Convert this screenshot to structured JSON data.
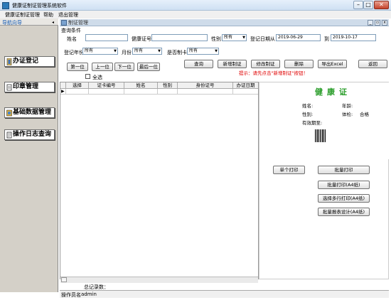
{
  "window": {
    "title": "健康证制证管理系统软件"
  },
  "menu": [
    "健康证制证管理",
    "帮助",
    "退出管理"
  ],
  "nav": {
    "title": "导航向导",
    "items": [
      "办证登记",
      "印章管理",
      "基础数据管理",
      "操作日志查询"
    ]
  },
  "inner": {
    "title": "制证管理"
  },
  "query": {
    "group_label": "查询条件",
    "name_label": "姓名",
    "name_value": "",
    "cert_label": "健康证号",
    "cert_value": "",
    "gender_label": "性别",
    "gender_value": "所有",
    "date_label": "登记日期从",
    "date_from": "2019-06-29",
    "date_to_label": "到",
    "date_to": "2019-10-17",
    "year_label": "登记年份",
    "year_value": "所有",
    "month_label": "月份",
    "month_value": "所有",
    "made_label": "是否制卡",
    "made_value": "所有",
    "first": "第一位",
    "prev": "上一位",
    "next": "下一位",
    "last": "最后一位",
    "select_all": "全选",
    "search": "查询",
    "add": "新增制证",
    "edit": "修改制证",
    "delete": "删除",
    "export": "导出Excel",
    "back": "返回",
    "hint": "提示：请先点击\"新增制证\"按钮！"
  },
  "grid": {
    "columns": [
      "选择",
      "证卡编号",
      "姓名",
      "性别",
      "身份证号",
      "办证日期"
    ]
  },
  "card": {
    "title": "健康证",
    "name_label": "姓名:",
    "age_label": "年龄:",
    "gender_label": "性别:",
    "result_label": "体检:",
    "result_value": "合格",
    "expiry_label": "有效期至:"
  },
  "print": {
    "single": "单个打印",
    "batch": "批量打印",
    "batch_a4": "批量打印(A4纸)",
    "multi_a4": "选择多行打印(A4纸)",
    "design_a4": "批量报表设计(A4纸)"
  },
  "status": {
    "total_label": "总记录数：",
    "total_value": "",
    "operator_label": "操作员名",
    "operator_value": "admin"
  }
}
